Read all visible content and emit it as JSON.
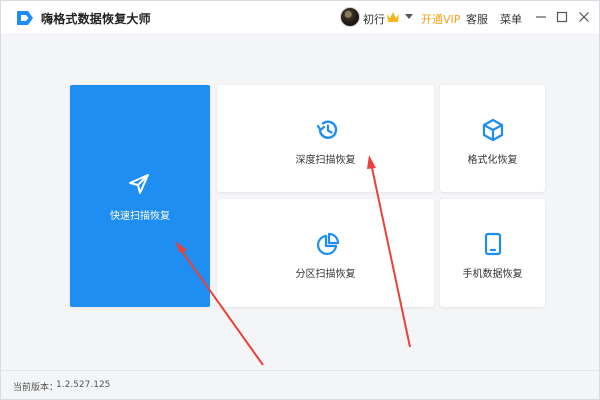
{
  "app": {
    "title": "嗨格式数据恢复大师",
    "logo_icon": "app-logo-icon",
    "brand_color": "#1f8ef2"
  },
  "header": {
    "user_name": "初行",
    "vip_label": "开通VIP",
    "vip_color": "#f2a31a",
    "service_label": "客服",
    "menu_label": "菜单",
    "window_controls": [
      "minimize-icon",
      "maximize-icon",
      "close-icon"
    ]
  },
  "cards": {
    "quick_scan": {
      "label": "快速扫描恢复",
      "icon": "send-icon"
    },
    "deep_scan": {
      "label": "深度扫描恢复",
      "icon": "history-clock-icon"
    },
    "format_recover": {
      "label": "格式化恢复",
      "icon": "cube-icon"
    },
    "partition_scan": {
      "label": "分区扫描恢复",
      "icon": "pie-chart-icon"
    },
    "phone_recover": {
      "label": "手机数据恢复",
      "icon": "tablet-icon"
    }
  },
  "footer": {
    "version_label": "当前版本：",
    "version_value": "1.2.527.125"
  },
  "annotations": {
    "arrow_color": "#e8423a"
  }
}
